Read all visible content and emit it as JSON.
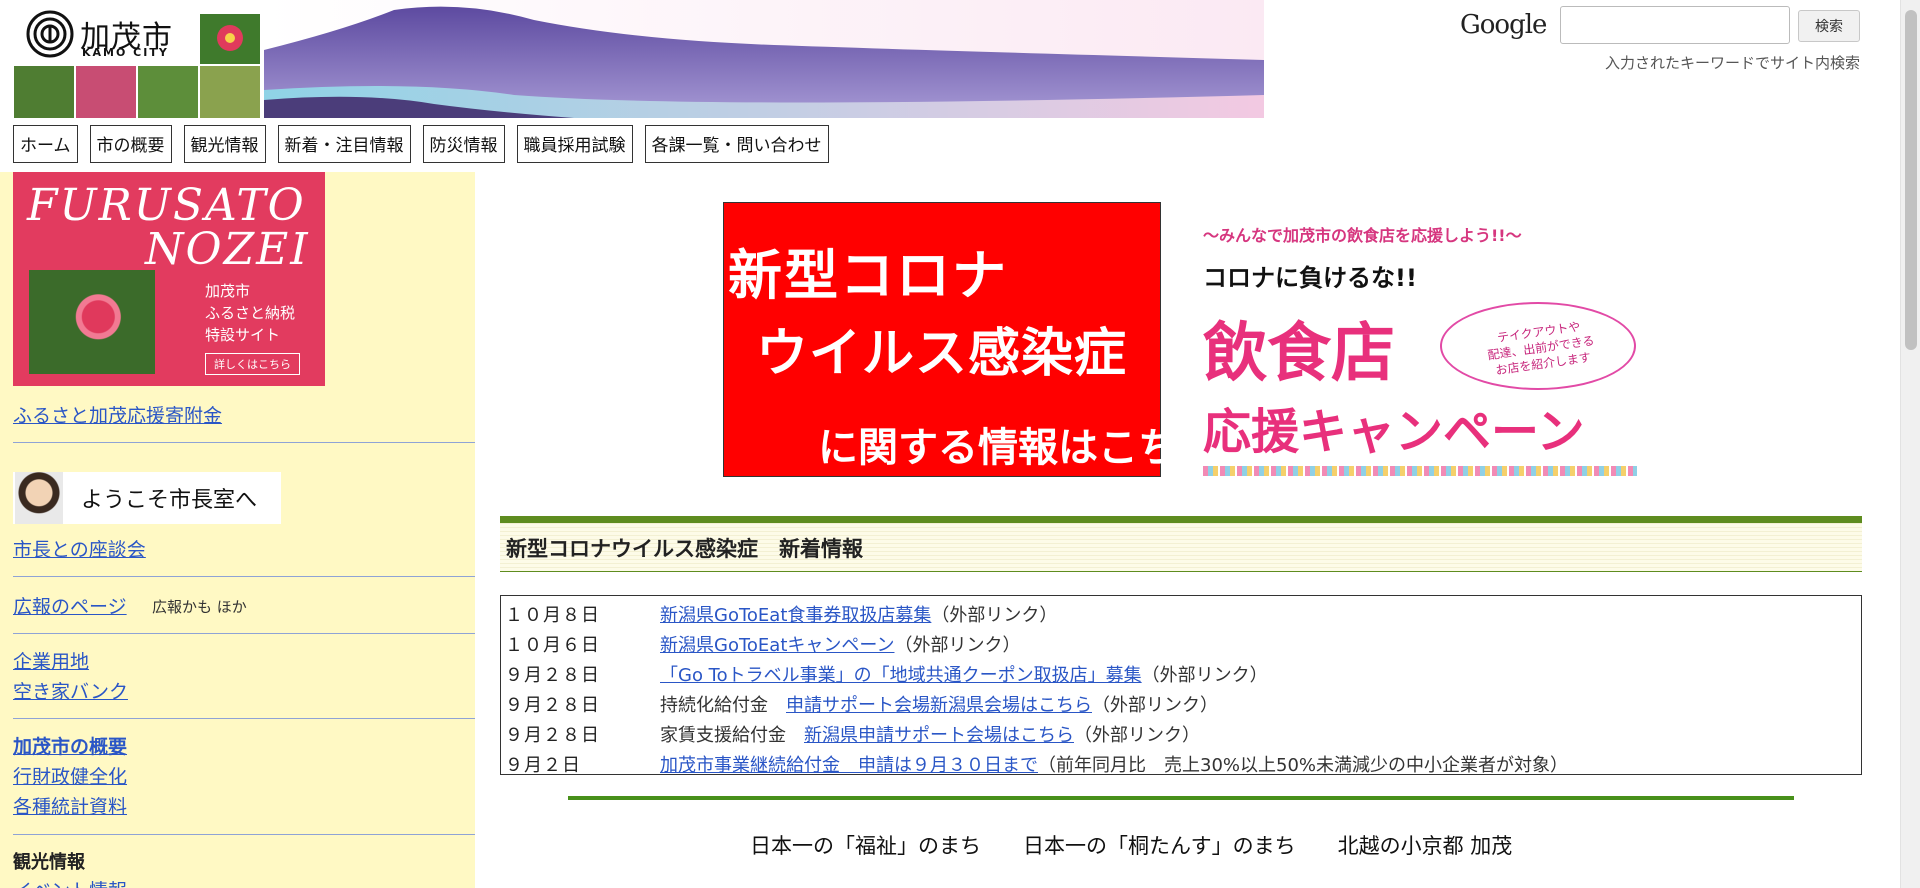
{
  "header": {
    "logo_name": "加茂市",
    "logo_en": "KAMO CITY"
  },
  "search": {
    "brand": "Google",
    "input_value": "",
    "button_label": "検索",
    "hint": "入力されたキーワードでサイト内検索"
  },
  "nav": {
    "items": [
      "ホーム",
      "市の概要",
      "観光情報",
      "新着・注目情報",
      "防災情報",
      "職員採用試験",
      "各課一覧・問い合わせ"
    ]
  },
  "sidebar": {
    "furusato_banner": {
      "line1": "FURUSATO",
      "line2": "NOZEI",
      "text": "加茂市\nふるさと納税\n特設サイト",
      "more": "詳しくはこちら"
    },
    "furusato_link": "ふるさと加茂応援寄附金",
    "mayor_banner": "ようこそ市長室へ",
    "mayor_link": "市長との座談会",
    "pr_link": "広報のページ",
    "pr_note": "広報かも ほか",
    "land_link": "企業用地",
    "akiya_link": "空き家バンク",
    "overview_link": "加茂市の概要",
    "finance_link": "行財政健全化",
    "stats_link": "各種統計資料",
    "tourism_head": "観光情報",
    "event_link": "イベント情報"
  },
  "main": {
    "corona_banner": {
      "line1": "新型コロナ",
      "line2": "ウイルス感染症",
      "line3": "に関する情報はこちら"
    },
    "campaign_banner": {
      "sub": "～みんなで加茂市の飲食店を応援しよう!!～",
      "line1": "コロナに負けるな!!",
      "line2": "飲食店",
      "line3": "応援キャンペーン",
      "bubble": "テイクアウトや\n配達、出前ができる\nお店を紹介します"
    },
    "news_title": "新型コロナウイルス感染症　新着情報",
    "news": [
      {
        "date": "１０月８日",
        "prefix": "",
        "link": "新潟県GoToEat食事券取扱店募集",
        "suffix": "（外部リンク）"
      },
      {
        "date": "１０月６日",
        "prefix": "",
        "link": "新潟県GoToEatキャンペーン",
        "suffix": "（外部リンク）"
      },
      {
        "date": "９月２８日",
        "prefix": "",
        "link": "「Go Toトラベル事業」の「地域共通クーポン取扱店」募集",
        "suffix": "（外部リンク）"
      },
      {
        "date": "９月２８日",
        "prefix": "持続化給付金　",
        "link": "申請サポート会場新潟県会場はこちら",
        "suffix": "（外部リンク）"
      },
      {
        "date": "９月２８日",
        "prefix": "家賃支援給付金　",
        "link": "新潟県申請サポート会場はこちら",
        "suffix": "（外部リンク）"
      },
      {
        "date": "９月２日",
        "prefix": "",
        "link": "加茂市事業継続給付金　申請は９月３０日まで",
        "suffix": "（前年同月比　売上30%以上50%未満減少の中小企業者が対象）"
      }
    ],
    "tagline": "日本一の「福祉」のまち　　日本一の「桐たんす」のまち　　北越の小京都 加茂"
  },
  "colors": {
    "sidebar_bg": "#fff9c4",
    "link": "#2a56c6",
    "accent_green": "#5e8c1f",
    "corona_red": "#ff0000",
    "campaign_pink": "#e8307c"
  }
}
